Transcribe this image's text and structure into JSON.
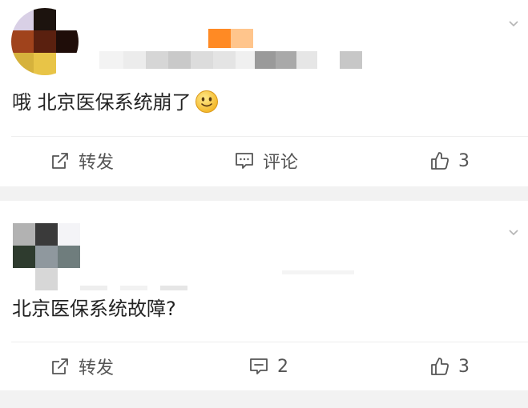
{
  "posts": [
    {
      "content": "哦 北京医保系统崩了",
      "emoji": "smile-emoji",
      "actions": {
        "repost_label": "转发",
        "comment_label": "评论",
        "like_count": "3"
      }
    },
    {
      "content": "北京医保系统故障?",
      "actions": {
        "repost_label": "转发",
        "comment_count": "2",
        "like_count": "3"
      }
    }
  ],
  "icons": {
    "repost": "repost-icon",
    "comment": "comment-icon",
    "like": "thumbs-up-icon",
    "menu": "chevron-down-icon"
  },
  "colors": {
    "text": "#222222",
    "action_text": "#555555",
    "separator": "#f2f2f2"
  }
}
